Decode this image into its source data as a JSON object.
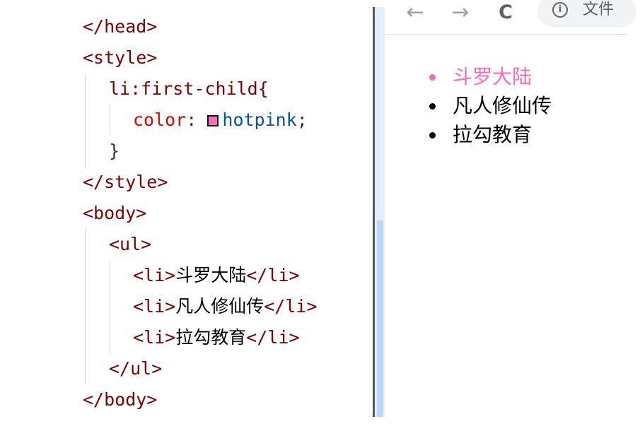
{
  "editor": {
    "lines": {
      "head_close": "</head>",
      "style_open": "<style>",
      "selector": "li:first-child{",
      "prop_name": "color",
      "prop_colon": ":",
      "prop_value": "hotpink",
      "prop_semicolon": ";",
      "brace_close": "}",
      "style_close": "</style>",
      "body_open": "<body>",
      "ul_open": "<ul>",
      "li_open": "<li>",
      "li_close": "</li>",
      "ul_close": "</ul>",
      "body_close": "</body>"
    },
    "li_items": [
      "斗罗大陆",
      "凡人修仙传",
      "拉勾教育"
    ],
    "swatch_color": "#ff69b4"
  },
  "browser": {
    "nav": {
      "back_icon": "←",
      "forward_icon": "→",
      "reload_icon": "C"
    },
    "address": {
      "info_icon": "i",
      "text": "文件"
    },
    "list": {
      "items": [
        "斗罗大陆",
        "凡人修仙传",
        "拉勾教育"
      ],
      "first_item_color": "#ff69b4"
    }
  }
}
